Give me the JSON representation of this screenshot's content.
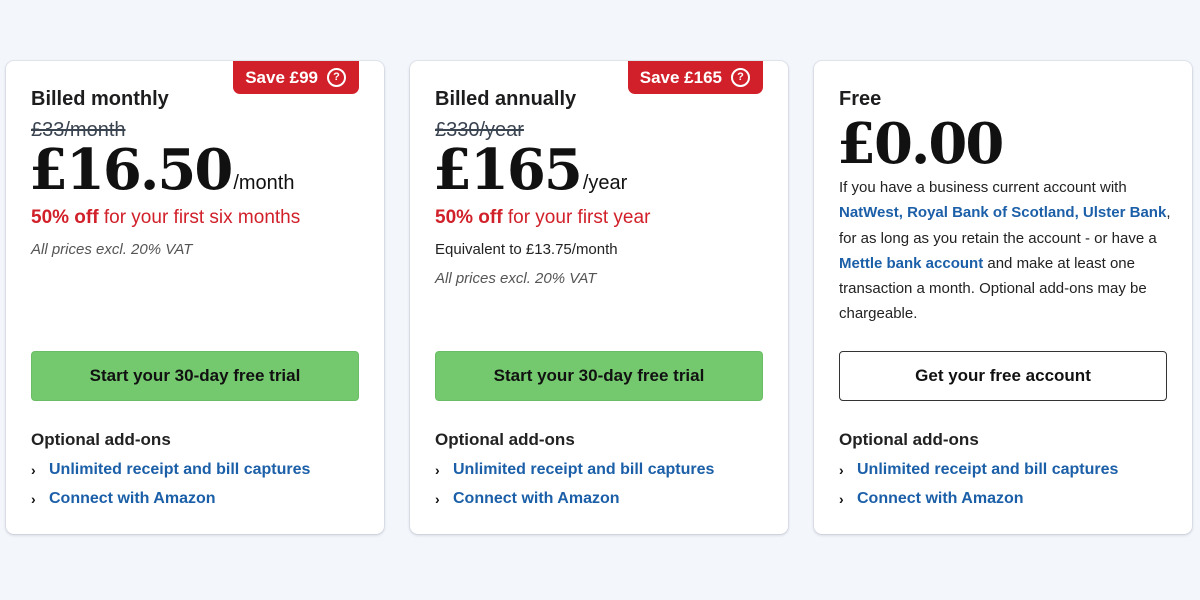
{
  "plans": [
    {
      "badge": "Save £99",
      "name": "Billed monthly",
      "old_price": "£33/month",
      "price": "£16.50",
      "period": "/month",
      "offer_bold": "50% off",
      "offer_rest": " for your first six months",
      "vat": "All prices excl. 20% VAT",
      "cta": "Start your 30-day free trial"
    },
    {
      "badge": "Save £165",
      "name": "Billed annually",
      "old_price": "£330/year",
      "price": "£165",
      "period": "/year",
      "offer_bold": "50% off",
      "offer_rest": " for your first year",
      "equivalent": "Equivalent to £13.75/month",
      "vat": "All prices excl. 20% VAT",
      "cta": "Start your 30-day free trial"
    },
    {
      "name": "Free",
      "price": "£0.00",
      "desc_1": "If you have a business current account with ",
      "desc_link_1": "NatWest, Royal Bank of Scotland, Ulster Bank",
      "desc_2": ", for as long as you retain the account - or have a ",
      "desc_link_2": "Mettle bank account",
      "desc_3": " and make at least one transaction a month. Optional add-ons may be chargeable.",
      "cta": "Get your free account"
    }
  ],
  "addons": {
    "title": "Optional add-ons",
    "items": [
      "Unlimited receipt and bill captures",
      "Connect with Amazon"
    ],
    "chevron": "›"
  },
  "icons": {
    "badge_icon": "help-circle-icon",
    "addon_icon": "chevron-right-icon"
  },
  "colors": {
    "accent_red": "#d1202a",
    "cta_green": "#74c96e",
    "link_blue": "#1b5fa8",
    "background": "#f3f6fb"
  }
}
